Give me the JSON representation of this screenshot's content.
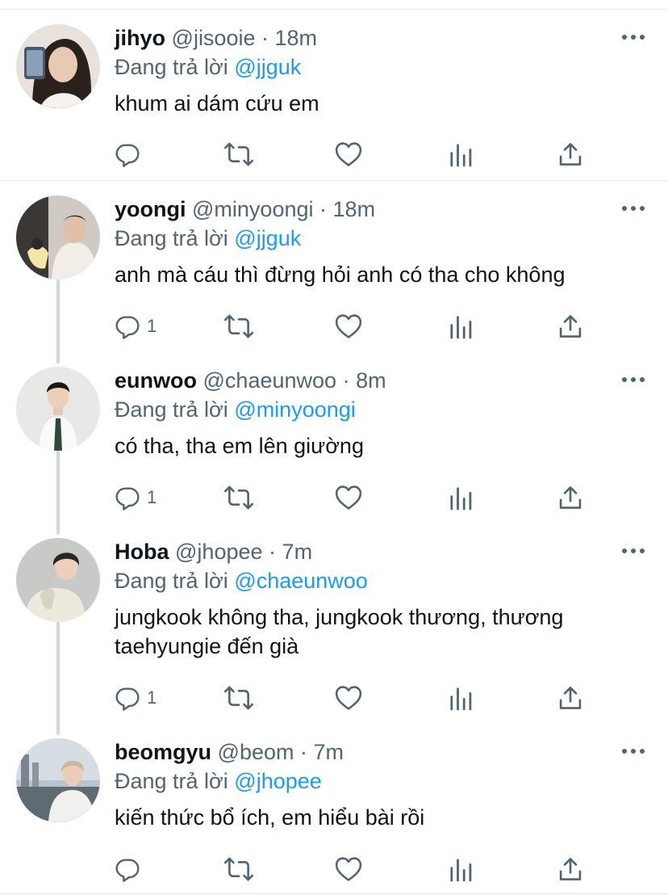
{
  "reply_prefix": "Đang trả lời",
  "tweets": [
    {
      "name": "jihyo",
      "handle": "@jisooie",
      "dot": "·",
      "time": "18m",
      "reply_to": "@jjguk",
      "text": "khum ai dám cứu em",
      "reply_count": ""
    },
    {
      "name": "yoongi",
      "handle": "@minyoongi",
      "dot": "·",
      "time": "18m",
      "reply_to": "@jjguk",
      "text": "anh mà cáu thì đừng hỏi anh có tha cho không",
      "reply_count": "1"
    },
    {
      "name": "eunwoo",
      "handle": "@chaeunwoo",
      "dot": "·",
      "time": "8m",
      "reply_to": "@minyoongi",
      "text": "có tha, tha em lên giường",
      "reply_count": "1"
    },
    {
      "name": "Hoba",
      "handle": "@jhopee",
      "dot": "·",
      "time": "7m",
      "reply_to": "@chaeunwoo",
      "text": "jungkook không tha, jungkook thương, thương taehyungie đến già",
      "reply_count": "1"
    },
    {
      "name": "beomgyu",
      "handle": "@beom",
      "dot": "·",
      "time": "7m",
      "reply_to": "@jhopee",
      "text": "kiến thức bổ ích, em hiểu bài rồi",
      "reply_count": ""
    }
  ],
  "icons": {
    "reply": "reply-icon",
    "retweet": "retweet-icon",
    "like": "like-icon",
    "analytics": "analytics-icon",
    "share": "share-icon",
    "more": "more-icon"
  },
  "colors": {
    "link": "#1d9bf0",
    "secondary": "#536471",
    "text": "#0f1419",
    "divider": "#e6e9ec"
  }
}
